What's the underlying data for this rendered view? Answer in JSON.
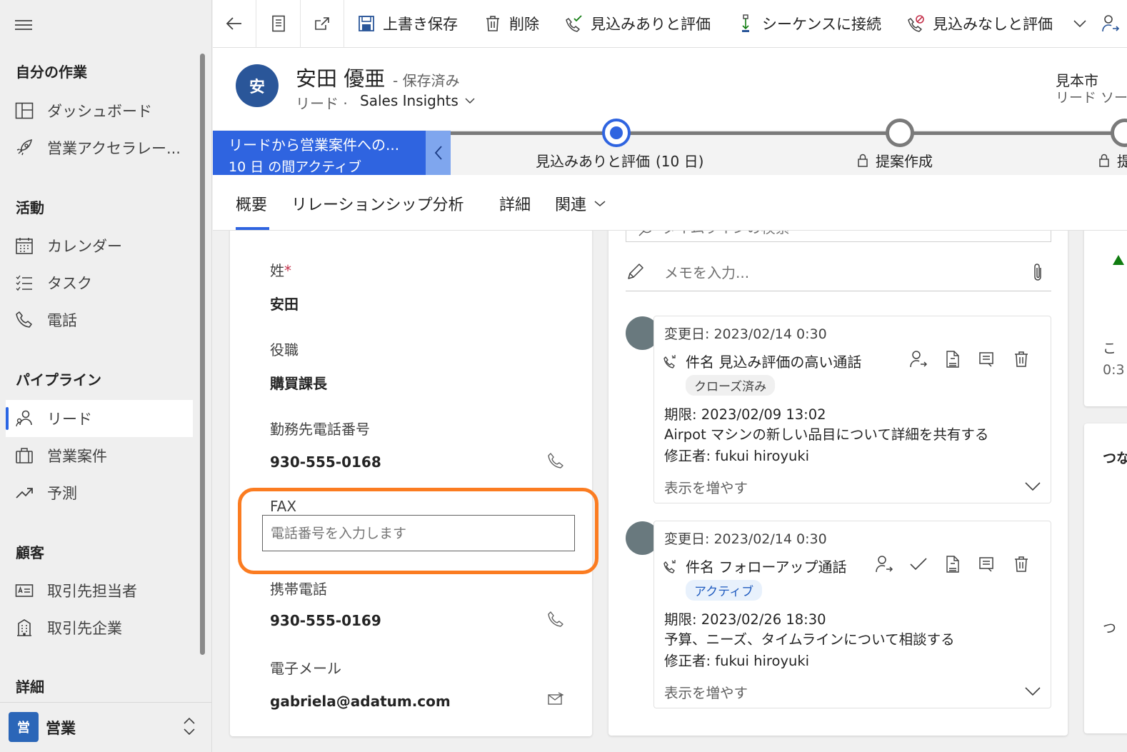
{
  "sidebar": {
    "groups": {
      "my_work": "自分の作業",
      "activities": "活動",
      "pipeline": "パイプライン",
      "customers": "顧客",
      "details": "詳細"
    },
    "items": {
      "dashboard": "ダッシュボード",
      "accelerator": "営業アクセラレー...",
      "calendar": "カレンダー",
      "tasks": "タスク",
      "phone": "電話",
      "leads": "リード",
      "opportunities": "営業案件",
      "forecast": "予測",
      "contacts": "取引先担当者",
      "accounts": "取引先企業"
    },
    "area": {
      "badge": "営",
      "name": "営業"
    }
  },
  "toolbar": {
    "save": "上書き保存",
    "delete": "削除",
    "qualify": "見込みありと評価",
    "sequence": "シーケンスに接続",
    "disqualify": "見込みなしと評価"
  },
  "header": {
    "avatar_initial": "安",
    "name": "安田 優亜",
    "status": "- 保存済み",
    "entity": "リード",
    "separator": "·",
    "form": "Sales Insights",
    "right_value": "見本市",
    "right_label": "リード ソー"
  },
  "bpf": {
    "process_name": "リードから営業案件への...",
    "active_duration": "10 日 の間アクティブ",
    "stages": [
      {
        "label": "見込みありと評価",
        "duration": "(10 日)"
      },
      {
        "label": "提案作成"
      },
      {
        "label": "提"
      }
    ]
  },
  "tabs": {
    "summary": "概要",
    "relationship": "リレーションシップ分析",
    "details": "詳細",
    "related": "関連"
  },
  "form": {
    "last_name": {
      "label": "姓",
      "required_mark": "*",
      "value": "安田"
    },
    "job_title": {
      "label": "役職",
      "value": "購買課長"
    },
    "business_phone": {
      "label": "勤務先電話番号",
      "value": "930-555-0168"
    },
    "fax": {
      "label": "FAX",
      "value": "",
      "placeholder": "電話番号を入力します"
    },
    "mobile_phone": {
      "label": "携帯電話",
      "value": "930-555-0169"
    },
    "email": {
      "label": "電子メール",
      "value": "gabriela@adatum.com"
    }
  },
  "timeline": {
    "search_placeholder": "タイムラインの検索",
    "note_placeholder": "メモを入力...",
    "entries": [
      {
        "modified": "変更日: 2023/02/14 0:30",
        "subject": "件名 見込み評価の高い通話",
        "status": "クローズ済み",
        "due": "期限: 2023/02/09 13:02",
        "description": "Airpot マシンの新しい品目について詳細を共有する",
        "modified_by": "修正者: fukui hiroyuki",
        "show_more": "表示を増やす"
      },
      {
        "modified": "変更日: 2023/02/14 0:30",
        "subject": "件名 フォローアップ通話",
        "status": "アクティブ",
        "due": "期限: 2023/02/26 18:30",
        "description": "予算、ニーズ、タイムラインについて相談する",
        "modified_by": "修正者: fukui hiroyuki",
        "show_more": "表示を増やす"
      }
    ]
  },
  "right_panel": {
    "text1": "こ",
    "text2": "0:3",
    "heading": "つな",
    "text3": "つ"
  },
  "colors": {
    "accent": "#2f64e0",
    "highlight": "#fb7c21",
    "avatar": "#2a5699",
    "closed_badge_bg": "#f0f0f0",
    "active_badge_bg": "#e8f1fc",
    "active_badge_fg": "#1f5bbf"
  }
}
